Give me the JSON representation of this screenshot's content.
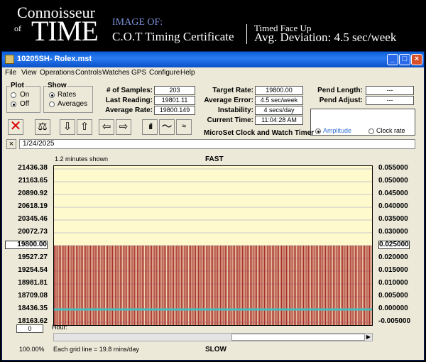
{
  "banner": {
    "logo_top": "Connoisseur",
    "logo_of": "of",
    "logo_main": "TIME",
    "image_of_label": "IMAGE OF:",
    "cert_title": "C.O.T Timing Certificate",
    "timed_position": "Timed Face Up",
    "avg_deviation": "Avg. Deviation: 4.5 sec/week"
  },
  "window": {
    "title": "10205SH- Rolex.mst",
    "minimize": "_",
    "maximize": "□",
    "close": "×"
  },
  "menu": [
    "File",
    "View",
    "Operations",
    "Controls",
    "Watches",
    "GPS",
    "Configure",
    "Help"
  ],
  "plot_group": {
    "label": "Plot",
    "on": "On",
    "off": "Off",
    "selected": "Off"
  },
  "show_group": {
    "label": "Show",
    "rates": "Rates",
    "averages": "Averages",
    "selected": "Rates"
  },
  "stats": {
    "samples_label": "# of Samples:",
    "samples": "203",
    "last_label": "Last Reading:",
    "last": "19801.11",
    "avg_label": "Average Rate:",
    "avg": "19800.149",
    "target_label": "Target Rate:",
    "target": "19800.00",
    "avgerr_label": "Average Error:",
    "avgerr": "4.5 sec/week",
    "instab_label": "Instability:",
    "instab": "4 secs/day",
    "time_label": "Current Time:",
    "time": "11:04:28 AM",
    "pendlen_label": "Pend Length:",
    "pendlen": "---",
    "pendadj_label": "Pend Adjust:",
    "pendadj": "---"
  },
  "mode": {
    "amplitude": "Amplitude",
    "clock_rate": "Clock rate",
    "selected": "Amplitude"
  },
  "toolbar_caption": "MicroSet Clock and Watch Timer",
  "toolbar_icons": [
    "clear-x-icon",
    "balance-scale-icon",
    "arrow-down-icon",
    "arrow-up-icon",
    "arrow-left-icon",
    "arrow-right-icon",
    "bar-chart-icon",
    "line-graph-icon",
    "waves-icon"
  ],
  "date_close": "×",
  "date": "1/24/2025",
  "chart": {
    "shown_text": "1.2 minutes shown",
    "fast_label": "FAST",
    "slow_label": "SLOW",
    "hour_label": "Hour:",
    "left_field": "0",
    "zoom": "100.00%",
    "grid_note": "Each grid line = 19.8 mins/day"
  },
  "chart_data": {
    "type": "bar",
    "left_axis_ticks": [
      "21436.38",
      "21163.65",
      "20890.92",
      "20618.19",
      "20345.46",
      "20072.73",
      "19800.00",
      "19527.27",
      "19254.54",
      "18981.81",
      "18709.08",
      "18436.35",
      "18163.62"
    ],
    "right_axis_ticks": [
      "0.055000",
      "0.050000",
      "0.045000",
      "0.040000",
      "0.035000",
      "0.030000",
      "0.025000",
      "0.020000",
      "0.015000",
      "0.010000",
      "0.005000",
      "0.000000",
      "-0.005000"
    ],
    "ylim": [
      18163.62,
      21436.38
    ],
    "bar_value": 19801.11,
    "bar_count": 203,
    "trend_right_value": 0.0,
    "highlighted_left": "19800.00",
    "highlighted_right": "0.025000",
    "colors": {
      "background": "#fffacd",
      "bar": "#a52a2a",
      "bar_gap": "#ffffff",
      "trend": "#40c0c0",
      "grid": "#c8c8c8"
    }
  }
}
